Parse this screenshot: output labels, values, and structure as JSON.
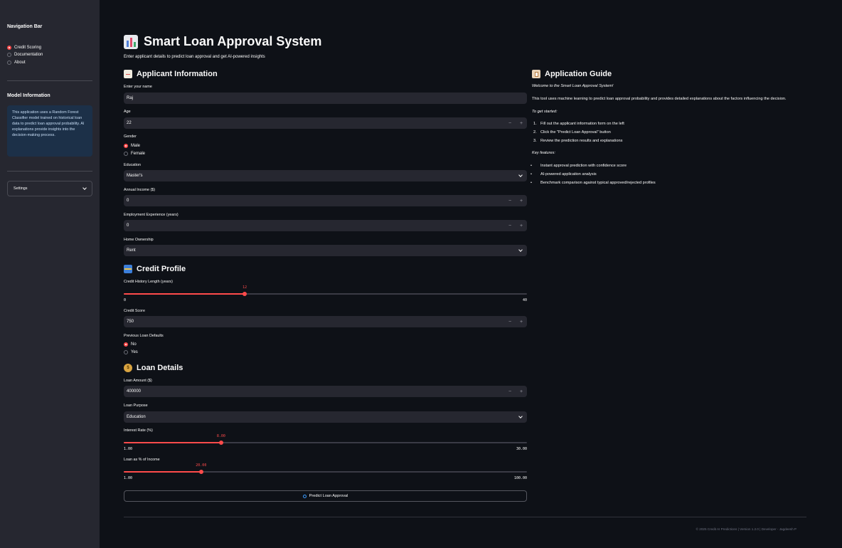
{
  "sidebar": {
    "nav_title": "Navigation Bar",
    "nav_items": [
      {
        "label": "Credit Scoring",
        "selected": true
      },
      {
        "label": "Documentation",
        "selected": false
      },
      {
        "label": "About",
        "selected": false
      }
    ],
    "model_title": "Model Information",
    "model_info": "This application uses a Random Forest Classifier model trained on historical loan data to predict loan approval probability. AI explanations provide insights into the decision-making process.",
    "settings_label": "Settings"
  },
  "header": {
    "title": "Smart Loan Approval System",
    "subtitle": "Enter applicant details to predict loan approval and get AI-powered insights"
  },
  "applicant": {
    "heading": "Applicant Information",
    "name_label": "Enter your name",
    "name_value": "Raj",
    "age_label": "Age",
    "age_value": "22",
    "gender_label": "Gender",
    "gender_options": [
      {
        "label": "Male",
        "selected": true
      },
      {
        "label": "Female",
        "selected": false
      }
    ],
    "education_label": "Education",
    "education_value": "Master's",
    "income_label": "Annual Income ($)",
    "income_value": "0",
    "experience_label": "Employment Experience (years)",
    "experience_value": "0",
    "home_label": "Home Ownership",
    "home_value": "Rent"
  },
  "credit": {
    "heading": "Credit Profile",
    "history_label": "Credit History Length (years)",
    "history_value": 12,
    "history_value_text": "12",
    "history_min": 0,
    "history_max": 40,
    "history_min_text": "0",
    "history_max_text": "40",
    "score_label": "Credit Score",
    "score_value": "750",
    "defaults_label": "Previous Loan Defaults",
    "defaults_options": [
      {
        "label": "No",
        "selected": true
      },
      {
        "label": "Yes",
        "selected": false
      }
    ]
  },
  "loan": {
    "heading": "Loan Details",
    "amount_label": "Loan Amount ($)",
    "amount_value": "400000",
    "purpose_label": "Loan Purpose",
    "purpose_value": "Education",
    "rate_label": "Interest Rate (%)",
    "rate_value": 8.0,
    "rate_value_text": "8.00",
    "rate_min": 1.0,
    "rate_max": 30.0,
    "rate_min_text": "1.00",
    "rate_max_text": "30.00",
    "pct_label": "Loan as % of Income",
    "pct_value": 20.0,
    "pct_value_text": "20.00",
    "pct_min": 1.0,
    "pct_max": 100.0,
    "pct_min_text": "1.00",
    "pct_max_text": "100.00"
  },
  "predict_button": "Predict Loan Approval",
  "guide": {
    "heading": "Application Guide",
    "welcome": "Welcome to the Smart Loan Approval System!",
    "intro": "This tool uses machine learning to predict loan approval probability and provides detailed explanations about the factors influencing the decision.",
    "get_started": "To get started:",
    "steps": [
      "Fill out the applicant information form on the left",
      "Click the \"Predict Loan Approval\" button",
      "Review the prediction results and explanations"
    ],
    "features_title": "Key features:",
    "features": [
      "Instant approval prediction with confidence score",
      "AI-powered application analysis",
      "Benchmark comparison against typical approved/rejected profiles"
    ]
  },
  "footer": "© 2025 Credit AI Predictions | Version 1.2.0 | Developer - Jagdeesh P",
  "colors": {
    "accent": "#ff4b4b",
    "background": "#0e1117",
    "sidebar": "#262730",
    "input": "#262730",
    "info_box": "#1c3048"
  },
  "icons": {
    "title": "bar-chart-icon",
    "applicant": "memo-icon",
    "credit": "credit-card-icon",
    "loan": "money-bag-icon",
    "guide": "clipboard-icon",
    "predict": "magnifier-icon"
  }
}
